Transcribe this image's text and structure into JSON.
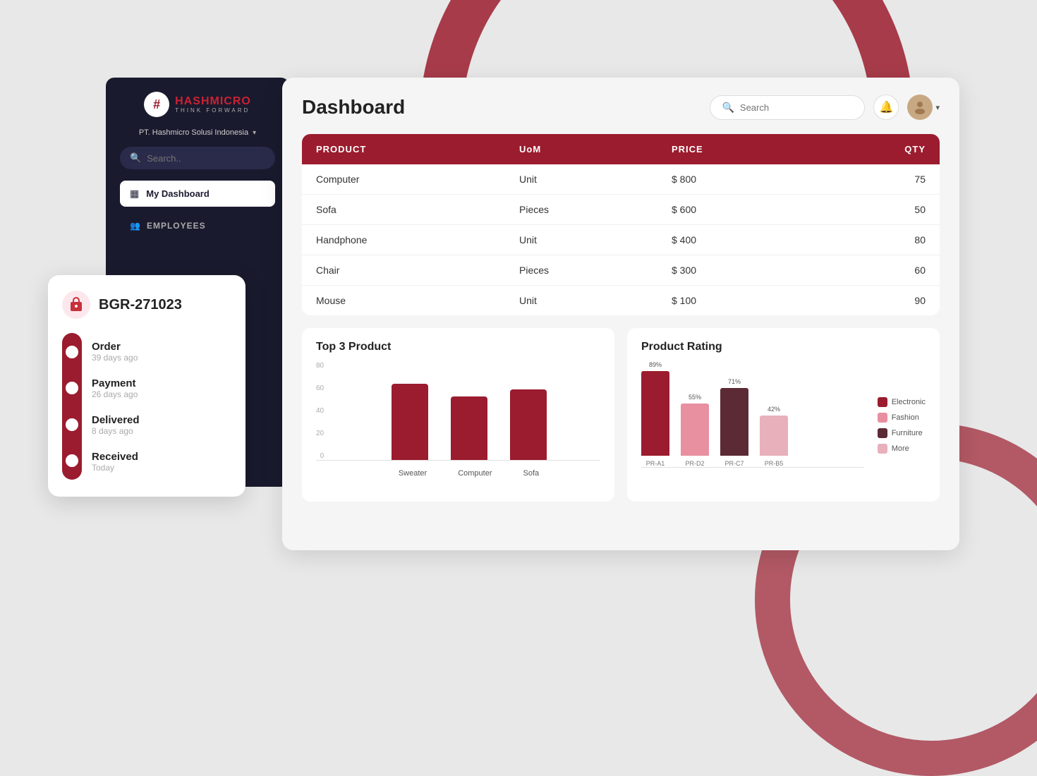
{
  "brand": {
    "logo_symbol": "#",
    "name_part1": "HASH",
    "name_part2": "MICRO",
    "tagline": "THINK FORWARD"
  },
  "company": {
    "name": "PT. Hashmicro Solusi Indonesia",
    "chevron": "▾"
  },
  "sidebar": {
    "search_placeholder": "Search..",
    "menu_items": [
      {
        "id": "dashboard",
        "label": "My Dashboard",
        "icon": "▦",
        "active": true
      },
      {
        "id": "employees",
        "label": "EMPLOYEES",
        "icon": "👥",
        "active": false
      }
    ]
  },
  "header": {
    "title": "Dashboard",
    "search_placeholder": "Search",
    "notification_icon": "🔔",
    "avatar_icon": "👤",
    "chevron": "▾"
  },
  "table": {
    "columns": [
      "PRODUCT",
      "UoM",
      "PRICE",
      "QTY"
    ],
    "rows": [
      {
        "product": "Computer",
        "uom": "Unit",
        "price": "$ 800",
        "qty": "75"
      },
      {
        "product": "Sofa",
        "uom": "Pieces",
        "price": "$ 600",
        "qty": "50"
      },
      {
        "product": "Handphone",
        "uom": "Unit",
        "price": "$ 400",
        "qty": "80"
      },
      {
        "product": "Chair",
        "uom": "Pieces",
        "price": "$ 300",
        "qty": "60"
      },
      {
        "product": "Mouse",
        "uom": "Unit",
        "price": "$ 100",
        "qty": "90"
      }
    ]
  },
  "top3_chart": {
    "title": "Top 3 Product",
    "y_labels": [
      "80",
      "60",
      "40",
      "20",
      "0"
    ],
    "bars": [
      {
        "label": "Sweater",
        "value": 72,
        "height_pct": 90
      },
      {
        "label": "Computer",
        "value": 60,
        "height_pct": 75
      },
      {
        "label": "Sofa",
        "value": 67,
        "height_pct": 84
      }
    ]
  },
  "rating_chart": {
    "title": "Product Rating",
    "bars": [
      {
        "label": "PR-A1",
        "pct": "89%",
        "height_pct": 89,
        "color": "#9b1c2e"
      },
      {
        "label": "PR-D2",
        "pct": "55%",
        "height_pct": 55,
        "color": "#e88fa0"
      },
      {
        "label": "PR-C7",
        "pct": "71%",
        "height_pct": 71,
        "color": "#5c2a35"
      },
      {
        "label": "PR-B5",
        "pct": "42%",
        "height_pct": 42,
        "color": "#e8b0bb"
      }
    ],
    "legend": [
      {
        "label": "Electronic",
        "color": "#9b1c2e"
      },
      {
        "label": "Fashion",
        "color": "#e88fa0"
      },
      {
        "label": "Furniture",
        "color": "#5c2a35"
      },
      {
        "label": "More",
        "color": "#e8b0bb"
      }
    ]
  },
  "order_card": {
    "icon": "📦",
    "id": "BGR-271023",
    "steps": [
      {
        "label": "Order",
        "time": "39 days ago"
      },
      {
        "label": "Payment",
        "time": "26 days ago"
      },
      {
        "label": "Delivered",
        "time": "8 days ago"
      },
      {
        "label": "Received",
        "time": "Today"
      }
    ]
  },
  "colors": {
    "primary": "#9b1c2e",
    "sidebar_bg": "#1a1a2e",
    "panel_bg": "#f5f5f5"
  }
}
